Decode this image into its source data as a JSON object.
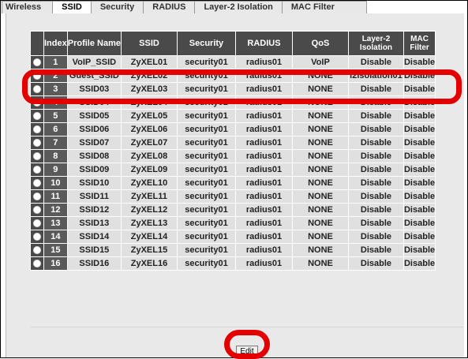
{
  "tabs": [
    "Wireless",
    "SSID",
    "Security",
    "RADIUS",
    "Layer-2 Isolation",
    "MAC Filter"
  ],
  "active_tab": "SSID",
  "table": {
    "headers": [
      "Index",
      "Profile Name",
      "SSID",
      "Security",
      "RADIUS",
      "QoS",
      "Layer-2 Isolation",
      "MAC Filter"
    ],
    "rows": [
      {
        "index": "1",
        "profile": "VoIP_SSID",
        "ssid": "ZyXEL01",
        "security": "security01",
        "radius": "radius01",
        "qos": "VoIP",
        "l2": "Disable",
        "mac": "Disable"
      },
      {
        "index": "2",
        "profile": "Guest_SSID",
        "ssid": "ZyXEL02",
        "security": "security01",
        "radius": "radius01",
        "qos": "NONE",
        "l2": "l2isolation01",
        "mac": "Disable"
      },
      {
        "index": "3",
        "profile": "SSID03",
        "ssid": "ZyXEL03",
        "security": "security01",
        "radius": "radius01",
        "qos": "NONE",
        "l2": "Disable",
        "mac": "Disable"
      },
      {
        "index": "4",
        "profile": "SSID04",
        "ssid": "ZyXEL04",
        "security": "security01",
        "radius": "radius01",
        "qos": "NONE",
        "l2": "Disable",
        "mac": "Disable"
      },
      {
        "index": "5",
        "profile": "SSID05",
        "ssid": "ZyXEL05",
        "security": "security01",
        "radius": "radius01",
        "qos": "NONE",
        "l2": "Disable",
        "mac": "Disable"
      },
      {
        "index": "6",
        "profile": "SSID06",
        "ssid": "ZyXEL06",
        "security": "security01",
        "radius": "radius01",
        "qos": "NONE",
        "l2": "Disable",
        "mac": "Disable"
      },
      {
        "index": "7",
        "profile": "SSID07",
        "ssid": "ZyXEL07",
        "security": "security01",
        "radius": "radius01",
        "qos": "NONE",
        "l2": "Disable",
        "mac": "Disable"
      },
      {
        "index": "8",
        "profile": "SSID08",
        "ssid": "ZyXEL08",
        "security": "security01",
        "radius": "radius01",
        "qos": "NONE",
        "l2": "Disable",
        "mac": "Disable"
      },
      {
        "index": "9",
        "profile": "SSID09",
        "ssid": "ZyXEL09",
        "security": "security01",
        "radius": "radius01",
        "qos": "NONE",
        "l2": "Disable",
        "mac": "Disable"
      },
      {
        "index": "10",
        "profile": "SSID10",
        "ssid": "ZyXEL10",
        "security": "security01",
        "radius": "radius01",
        "qos": "NONE",
        "l2": "Disable",
        "mac": "Disable"
      },
      {
        "index": "11",
        "profile": "SSID11",
        "ssid": "ZyXEL11",
        "security": "security01",
        "radius": "radius01",
        "qos": "NONE",
        "l2": "Disable",
        "mac": "Disable"
      },
      {
        "index": "12",
        "profile": "SSID12",
        "ssid": "ZyXEL12",
        "security": "security01",
        "radius": "radius01",
        "qos": "NONE",
        "l2": "Disable",
        "mac": "Disable"
      },
      {
        "index": "13",
        "profile": "SSID13",
        "ssid": "ZyXEL13",
        "security": "security01",
        "radius": "radius01",
        "qos": "NONE",
        "l2": "Disable",
        "mac": "Disable"
      },
      {
        "index": "14",
        "profile": "SSID14",
        "ssid": "ZyXEL14",
        "security": "security01",
        "radius": "radius01",
        "qos": "NONE",
        "l2": "Disable",
        "mac": "Disable"
      },
      {
        "index": "15",
        "profile": "SSID15",
        "ssid": "ZyXEL15",
        "security": "security01",
        "radius": "radius01",
        "qos": "NONE",
        "l2": "Disable",
        "mac": "Disable"
      },
      {
        "index": "16",
        "profile": "SSID16",
        "ssid": "ZyXEL16",
        "security": "security01",
        "radius": "radius01",
        "qos": "NONE",
        "l2": "Disable",
        "mac": "Disable"
      }
    ]
  },
  "edit_button_label": "Edit",
  "colors": {
    "highlight_ring": "#e30000",
    "header_bg": "#4a4a4a",
    "row_bg": "#e0e0e0"
  }
}
